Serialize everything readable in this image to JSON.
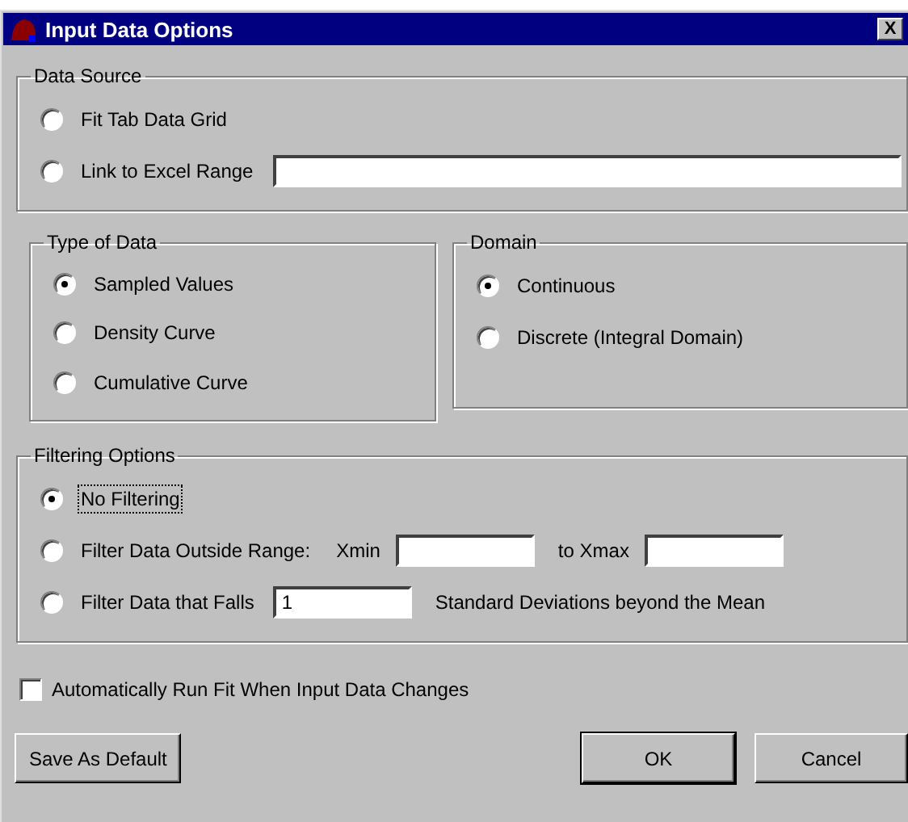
{
  "window": {
    "title": "Input Data Options",
    "close": "X"
  },
  "data_source": {
    "title": "Data Source",
    "options": [
      {
        "label": "Fit Tab Data Grid",
        "selected": false
      },
      {
        "label": "Link to Excel Range",
        "selected": false,
        "extras": [
          {
            "kind": "wide_field"
          }
        ]
      }
    ]
  },
  "type_of_data": {
    "title": "Type of Data",
    "options": [
      {
        "label": "Sampled Values",
        "selected": true
      },
      {
        "label": "Density Curve",
        "selected": false
      },
      {
        "label": "Cumulative Curve",
        "selected": false
      }
    ]
  },
  "domain": {
    "title": "Domain",
    "options": [
      {
        "label": "Continuous",
        "selected": true
      },
      {
        "label": "Discrete (Integral Domain)",
        "selected": false
      }
    ]
  },
  "filtering": {
    "title": "Filtering Options",
    "options": [
      {
        "label": "No Filtering",
        "selected": true,
        "focused": true
      },
      {
        "label": "Filter Data Outside Range:",
        "selected": false,
        "focused": false,
        "extras": [
          {
            "kind": "text",
            "text": "Xmin"
          },
          {
            "kind": "field"
          },
          {
            "kind": "text",
            "text": "to Xmax"
          },
          {
            "kind": "field"
          }
        ]
      },
      {
        "label": "Filter Data that Falls",
        "selected": false,
        "focused": false,
        "extras": [
          {
            "kind": "field",
            "value": "1"
          },
          {
            "kind": "text",
            "text": "Standard Deviations beyond the Mean"
          }
        ]
      }
    ]
  },
  "auto_run": {
    "label": "Automatically Run Fit When Input Data Changes",
    "checked": false
  },
  "buttons": [
    {
      "label": "Save As Default",
      "default": false
    },
    {
      "label": "OK",
      "default": true
    },
    {
      "label": "Cancel",
      "default": false
    }
  ]
}
